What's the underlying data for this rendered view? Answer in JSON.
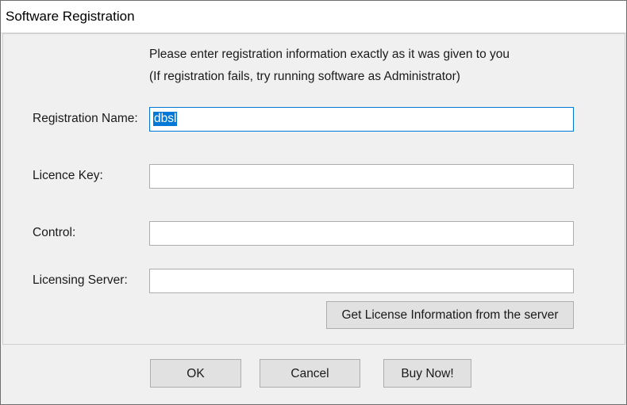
{
  "window": {
    "title": "Software Registration"
  },
  "instructions": {
    "line1": "Please enter registration information exactly as it was given to you",
    "line2": "(If registration fails, try running software as Administrator)"
  },
  "fields": {
    "registration_name": {
      "label": "Registration Name:",
      "value": "dbsl"
    },
    "licence_key": {
      "label": "Licence Key:",
      "value": ""
    },
    "control": {
      "label": "Control:",
      "value": ""
    },
    "licensing_server": {
      "label": "Licensing Server:",
      "value": ""
    }
  },
  "buttons": {
    "get_license": "Get License Information from the server",
    "ok": "OK",
    "cancel": "Cancel",
    "buy_now": "Buy Now!"
  },
  "colors": {
    "selection": "#0078d7",
    "button_face": "#e1e1e1",
    "dialog_bg": "#f0f0f0"
  }
}
